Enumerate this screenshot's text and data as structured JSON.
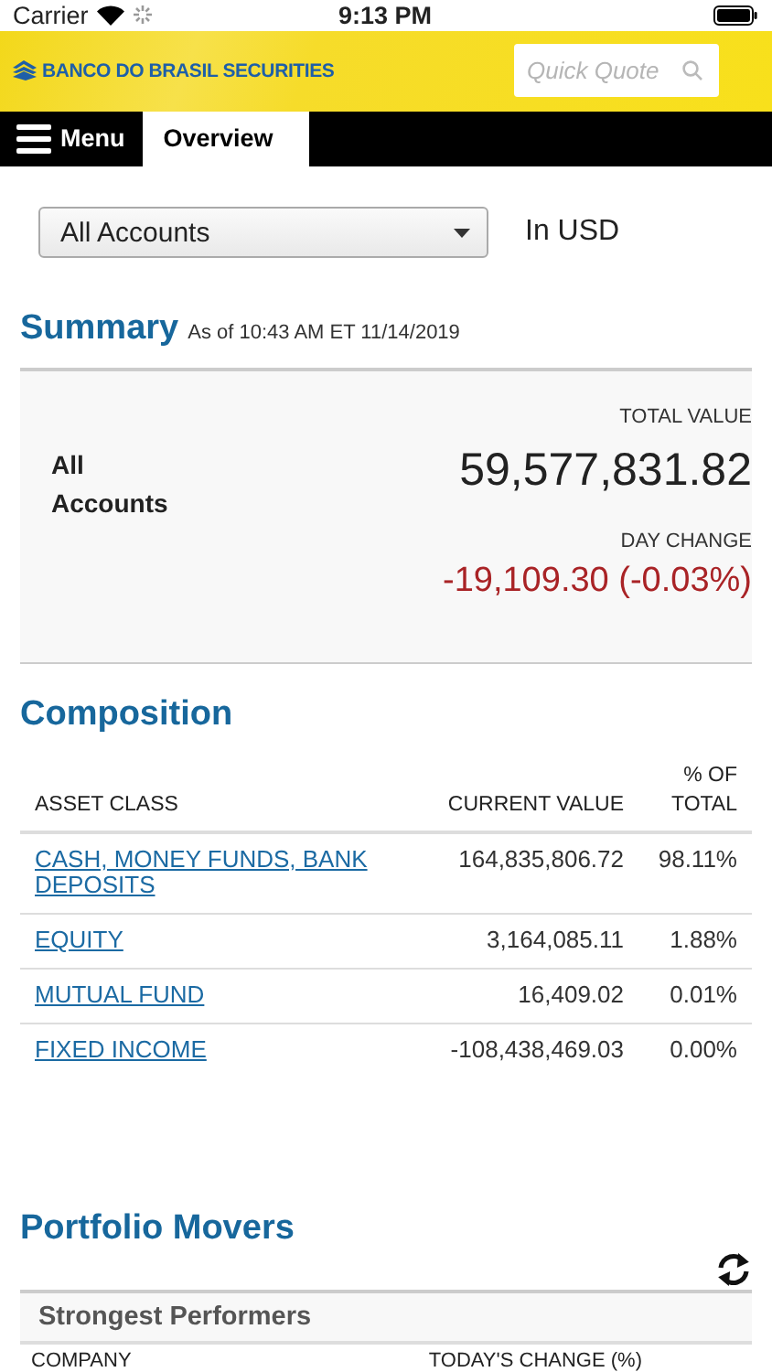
{
  "status_bar": {
    "carrier": "Carrier",
    "time": "9:13 PM"
  },
  "header": {
    "logo": "BANCO DO BRASIL SECURITIES",
    "search": {
      "placeholder": "Quick Quote"
    }
  },
  "nav": {
    "tabs": [
      {
        "label": "Menu",
        "kind": "menu",
        "selected": false
      },
      {
        "label": "Overview",
        "kind": "tab",
        "selected": true
      }
    ]
  },
  "account_select": {
    "value": "All Accounts"
  },
  "currency": "In USD",
  "summary": {
    "title": "Summary",
    "as_of": "As of 10:43 AM ET 11/14/2019",
    "account": "All Accounts",
    "total_label": "TOTAL VALUE",
    "total": "59,577,831.82",
    "change_label": "DAY CHANGE",
    "change": "-19,109.30 (-0.03%)",
    "negative": true
  },
  "composition": {
    "title": "Composition",
    "columns": [
      "ASSET CLASS",
      "CURRENT VALUE",
      "% OF TOTAL"
    ],
    "rows": [
      {
        "asset_class": "CASH, MONEY FUNDS, BANK DEPOSITS",
        "current_value": "164,835,806.72",
        "percent": "98.11%"
      },
      {
        "asset_class": "EQUITY",
        "current_value": "3,164,085.11",
        "percent": "1.88%"
      },
      {
        "asset_class": "MUTUAL FUND",
        "current_value": "16,409.02",
        "percent": "0.01%"
      },
      {
        "asset_class": "FIXED INCOME",
        "current_value": "-108,438,469.03",
        "percent": "0.00%"
      }
    ]
  },
  "movers": {
    "title": "Portfolio Movers",
    "panel_title": "Strongest Performers",
    "columns": [
      "COMPANY",
      "TODAY'S CHANGE (%)"
    ]
  }
}
